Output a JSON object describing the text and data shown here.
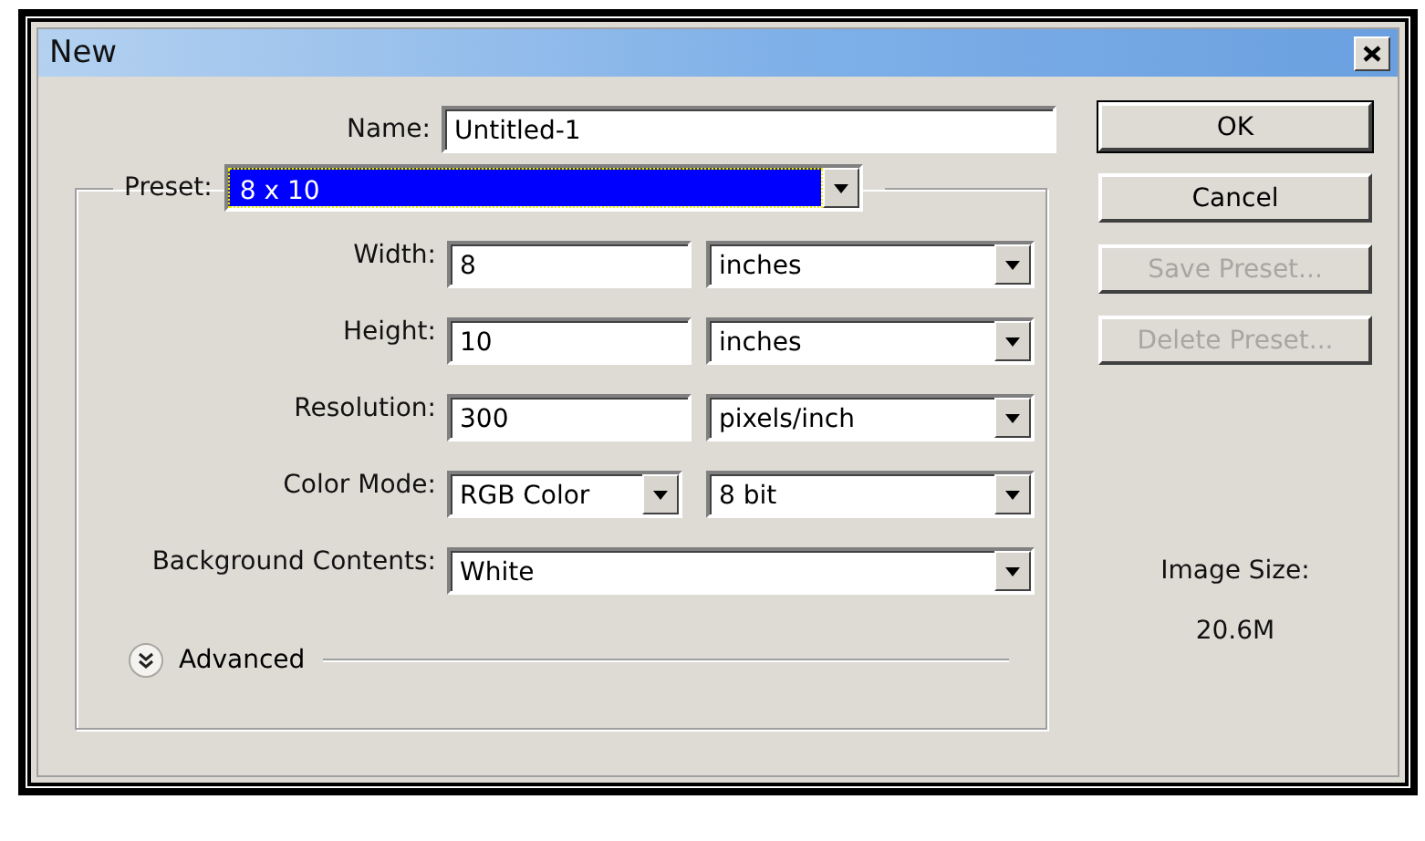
{
  "window": {
    "title": "New"
  },
  "name": {
    "label": "Name:",
    "value": "Untitled-1"
  },
  "preset": {
    "label": "Preset:",
    "value": "8 x 10",
    "highlighted": true
  },
  "rows": [
    {
      "kind": "field_select",
      "label": "Width:",
      "value": "8",
      "unit": "inches"
    },
    {
      "kind": "field_select",
      "label": "Height:",
      "value": "10",
      "unit": "inches"
    },
    {
      "kind": "field_select",
      "label": "Resolution:",
      "value": "300",
      "unit": "pixels/inch"
    },
    {
      "kind": "select_select",
      "label": "Color Mode:",
      "value": "RGB Color",
      "unit": "8 bit"
    },
    {
      "kind": "select",
      "label": "Background Contents:",
      "value": "White"
    }
  ],
  "advanced": {
    "label": "Advanced",
    "expanded": false
  },
  "buttons": [
    {
      "label": "OK",
      "default": true,
      "disabled": false
    },
    {
      "label": "Cancel",
      "default": false,
      "disabled": false
    },
    {
      "label": "Save Preset...",
      "default": false,
      "disabled": true
    },
    {
      "label": "Delete Preset...",
      "default": false,
      "disabled": true
    }
  ],
  "image_size": {
    "label": "Image Size:",
    "value": "20.6M"
  }
}
